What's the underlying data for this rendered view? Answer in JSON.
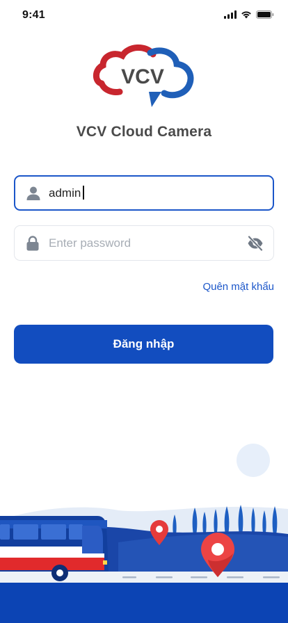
{
  "status_bar": {
    "time": "9:41",
    "icons": [
      "signal-icon",
      "wifi-icon",
      "battery-icon"
    ]
  },
  "brand": {
    "logo_text": "VCV",
    "app_title": "VCV Cloud Camera",
    "colors": {
      "red": "#c8262e",
      "blue": "#1f5fb8",
      "gray_text": "#4a4a4a"
    }
  },
  "login_form": {
    "username": {
      "value": "admin",
      "icon": "user-icon"
    },
    "password": {
      "value": "",
      "placeholder": "Enter password",
      "icon": "lock-icon",
      "toggle_icon": "eye-off-icon"
    },
    "forgot_password": "Quên mật khẩu",
    "submit_label": "Đăng nhập",
    "accent_color": "#124dbf"
  }
}
